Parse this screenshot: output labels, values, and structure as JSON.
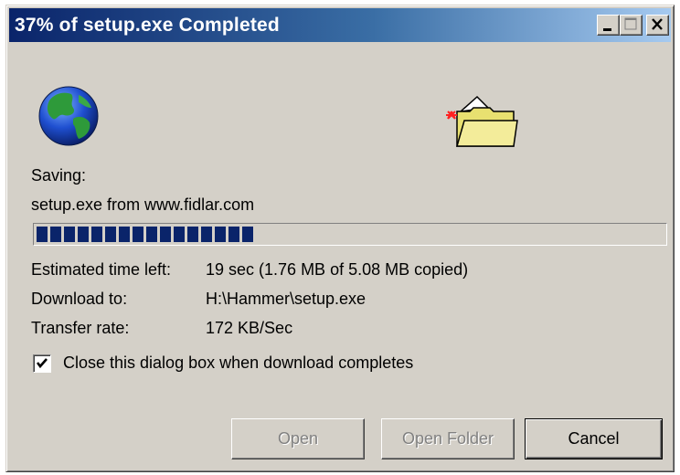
{
  "window": {
    "title": "37% of setup.exe Completed",
    "controls": {
      "minimize": "minimize-icon",
      "maximize": "maximize-icon",
      "close": "close-icon"
    }
  },
  "icons": {
    "globe": "globe-icon",
    "folder": "folder-icon"
  },
  "status": {
    "saving_label": "Saving:",
    "file_line": "setup.exe from www.fidlar.com"
  },
  "progress": {
    "percent": 37
  },
  "details": {
    "estimated_label": "Estimated time left:",
    "estimated_value": "19 sec (1.76 MB of 5.08 MB copied)",
    "download_to_label": "Download to:",
    "download_to_value": "H:\\Hammer\\setup.exe",
    "transfer_rate_label": "Transfer rate:",
    "transfer_rate_value": "172 KB/Sec"
  },
  "options": {
    "close_when_done_label": "Close this dialog box when download completes",
    "close_when_done_checked": true
  },
  "buttons": {
    "open": "Open",
    "open_folder": "Open Folder",
    "cancel": "Cancel"
  },
  "colors": {
    "title_start": "#0a246a",
    "title_end": "#a6caf0",
    "progress_block": "#0a246a",
    "face": "#d4d0c8"
  }
}
